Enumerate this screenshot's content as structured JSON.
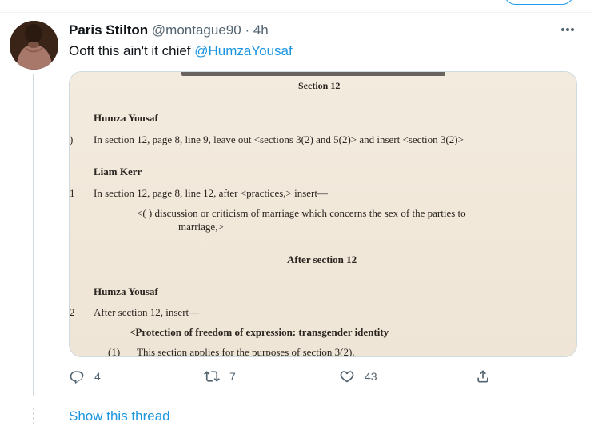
{
  "tweet": {
    "display_name": "Paris Stilton",
    "handle": "@montague90",
    "separator": "·",
    "time": "4h",
    "text": "Ooft this ain't it chief ",
    "mention": "@HumzaYousaf"
  },
  "media": {
    "header_fragment": "Section 12",
    "amendments": [
      {
        "marker": ")",
        "member": "Humza Yousaf",
        "text": "In section 12, page 8, line 9, leave out <sections 3(2) and 5(2)> and insert <section 3(2)>"
      },
      {
        "marker": "1",
        "member": "Liam Kerr",
        "text": "In section 12, page 8, line 12, after <practices,> insert—",
        "insert_line1": "<( )  discussion  or  criticism  of  marriage  which  concerns  the  sex  of  the  parties  to",
        "insert_line2": "marriage,>"
      }
    ],
    "subheading": "After section 12",
    "third": {
      "marker": "2",
      "member": "Humza Yousaf",
      "text": "After section 12, insert—",
      "heading": "<Protection of freedom of expression: transgender identity",
      "subsection_num": "(1)",
      "subsection_text": "This section applies for the purposes of section 3(2)."
    }
  },
  "actions": {
    "reply": {
      "count": "4",
      "icon": "reply-icon"
    },
    "retweet": {
      "count": "7",
      "icon": "retweet-icon"
    },
    "like": {
      "count": "43",
      "icon": "heart-icon"
    },
    "share": {
      "icon": "share-icon"
    }
  },
  "show_thread": "Show this thread",
  "colors": {
    "link": "#1b95e0",
    "muted": "#536471",
    "text": "#0f1419"
  }
}
